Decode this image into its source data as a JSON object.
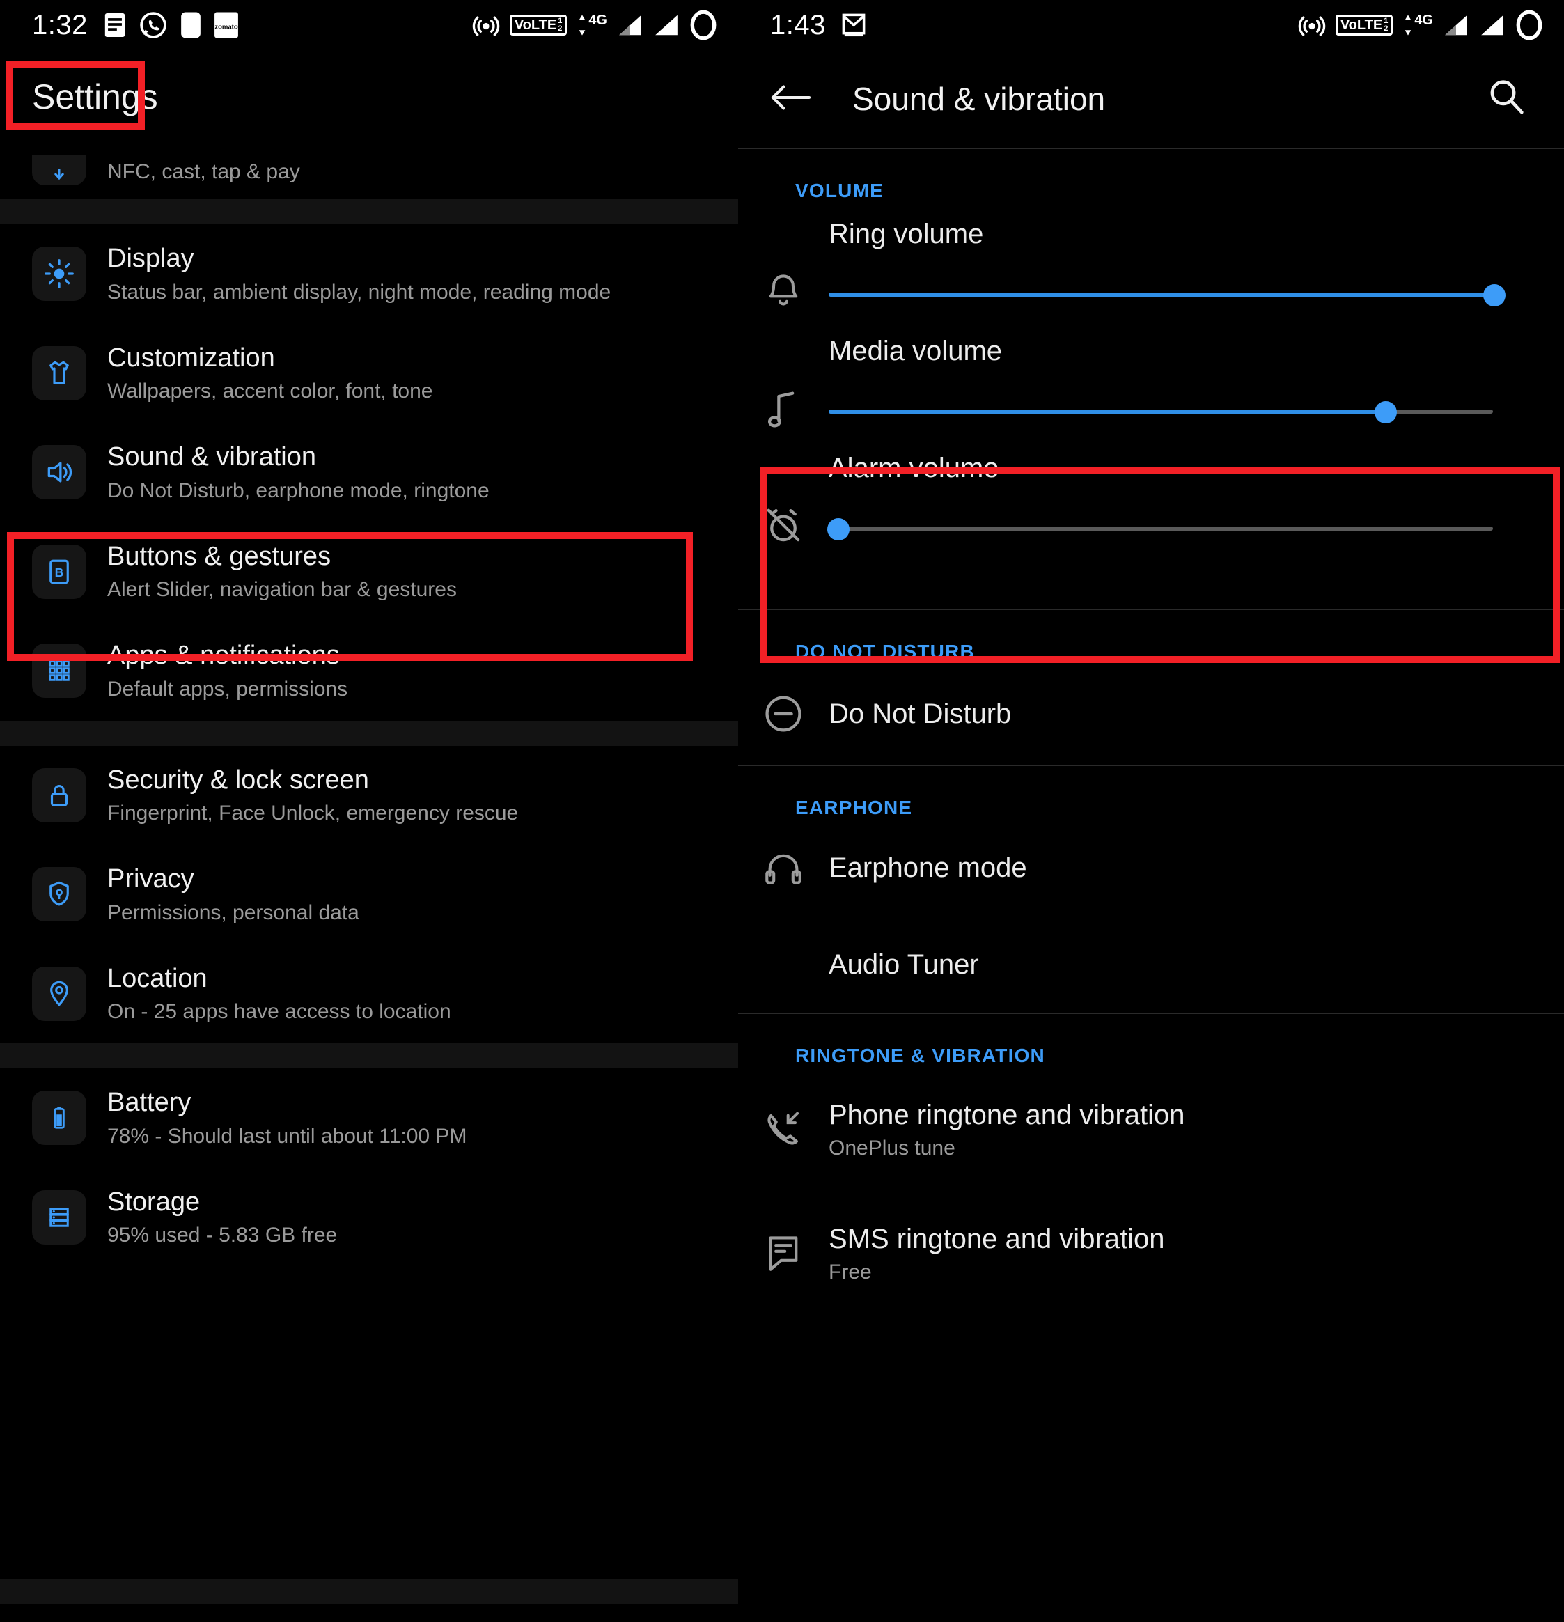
{
  "left_panel": {
    "statusbar": {
      "clock": "1:32",
      "left_icons": [
        "notes-notification-icon",
        "whatsapp-icon",
        "app-notification-icon",
        "zomato-icon"
      ],
      "zomato_label": "zomato",
      "right_icons": [
        "hotspot-icon",
        "volte-icon",
        "mobile-data-arrows-icon",
        "signal-sim1-icon",
        "signal-sim2-icon",
        "battery-ring-icon"
      ],
      "volte_text": "VoLTE",
      "volte_sim": "1",
      "volte_sim2": "2",
      "network_type": "4G"
    },
    "title": "Settings",
    "items": [
      {
        "icon": "nfc-cast-icon",
        "title": "",
        "sub": "NFC, cast, tap & pay"
      },
      {
        "icon": "brightness-icon",
        "title": "Display",
        "sub": "Status bar, ambient display, night mode, reading mode"
      },
      {
        "icon": "tshirt-icon",
        "title": "Customization",
        "sub": "Wallpapers, accent color, font, tone"
      },
      {
        "icon": "speaker-icon",
        "title": "Sound & vibration",
        "sub": "Do Not Disturb, earphone mode, ringtone"
      },
      {
        "icon": "button-b-icon",
        "title": "Buttons & gestures",
        "sub": "Alert Slider, navigation bar & gestures"
      },
      {
        "icon": "apps-grid-icon",
        "title": "Apps & notifications",
        "sub": "Default apps, permissions"
      },
      {
        "icon": "lock-icon",
        "title": "Security & lock screen",
        "sub": "Fingerprint, Face Unlock, emergency rescue"
      },
      {
        "icon": "shield-key-icon",
        "title": "Privacy",
        "sub": "Permissions, personal data"
      },
      {
        "icon": "location-pin-icon",
        "title": "Location",
        "sub": "On - 25 apps have access to location"
      },
      {
        "icon": "battery-icon",
        "title": "Battery",
        "sub": "78% - Should last until about 11:00 PM"
      },
      {
        "icon": "storage-icon",
        "title": "Storage",
        "sub": "95% used - 5.83 GB free"
      }
    ]
  },
  "right_panel": {
    "statusbar": {
      "clock": "1:43",
      "left_icons": [
        "gmail-icon"
      ],
      "right_icons": [
        "hotspot-icon",
        "volte-icon",
        "mobile-data-arrows-icon",
        "signal-sim1-icon",
        "signal-sim2-icon",
        "battery-ring-icon"
      ],
      "volte_text": "VoLTE",
      "volte_sim": "1",
      "volte_sim2": "2",
      "network_type": "4G"
    },
    "appbar": {
      "back_icon": "arrow-left-icon",
      "title": "Sound & vibration",
      "search_icon": "search-icon"
    },
    "sections": {
      "volume": {
        "label": "VOLUME",
        "sliders": [
          {
            "icon": "bell-icon",
            "label": "Ring volume",
            "value": 100
          },
          {
            "icon": "music-note-icon",
            "label": "Media volume",
            "value": 80
          },
          {
            "icon": "alarm-off-icon",
            "label": "Alarm volume",
            "value": 0
          }
        ]
      },
      "dnd": {
        "label": "DO NOT DISTURB",
        "items": [
          {
            "icon": "minus-circle-icon",
            "title": "Do Not Disturb",
            "sub": ""
          }
        ]
      },
      "earphone": {
        "label": "EARPHONE",
        "items": [
          {
            "icon": "headphones-icon",
            "title": "Earphone mode",
            "sub": ""
          },
          {
            "icon": "",
            "title": "Audio Tuner",
            "sub": ""
          }
        ]
      },
      "ringtone": {
        "label": "RINGTONE & VIBRATION",
        "items": [
          {
            "icon": "incoming-call-icon",
            "title": "Phone ringtone and vibration",
            "sub": "OnePlus tune"
          },
          {
            "icon": "message-icon",
            "title": "SMS ringtone and vibration",
            "sub": "Free"
          }
        ]
      }
    }
  },
  "annotations": {
    "highlight_color": "#f22026",
    "boxes": [
      {
        "name": "settings-title-highlight"
      },
      {
        "name": "sound-vibration-row-highlight"
      },
      {
        "name": "media-volume-highlight"
      }
    ]
  }
}
